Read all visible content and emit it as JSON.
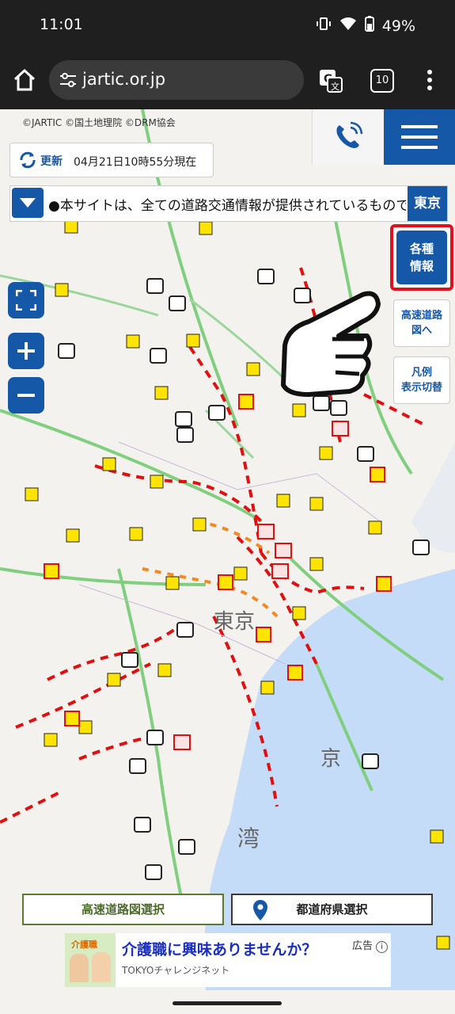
{
  "status_bar": {
    "time": "11:01",
    "battery": "49%"
  },
  "browser": {
    "url": "jartic.or.jp",
    "tab_count": "10"
  },
  "map": {
    "attribution": "©JARTIC  ©国土地理院  ©DRM協会",
    "update": {
      "label": "更新",
      "timestamp": "04月21日10時55分現在"
    },
    "ticker": {
      "text": "●本サイトは、全ての道路交通情報が提供されているものではありません",
      "region": "東京"
    },
    "side_menu": {
      "info": "各種\n情報",
      "expressway": "高速道路\n図へ",
      "legend": "凡例\n表示切替"
    },
    "bottom_buttons": {
      "expressway_select": "高速道路図選択",
      "prefecture_select": "都道府県選択"
    },
    "labels": [
      "東京",
      "京",
      "湾"
    ]
  },
  "ad": {
    "title": "介護職に興味ありませんか？",
    "advertiser": "TOKYOチャレンジネット",
    "badge": "広告",
    "thumb_text": "介護職"
  },
  "colors": {
    "brand_blue": "#1658a8",
    "highlight_red": "#e0101e",
    "congestion_red": "#e01010",
    "congestion_orange": "#f08a24"
  }
}
